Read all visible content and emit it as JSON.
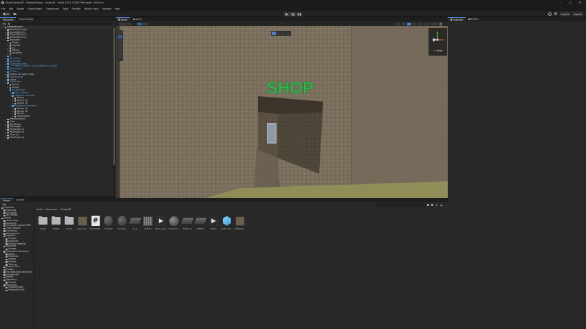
{
  "window": {
    "title": "SeanGamesVR - SampleScene - Android - Unity 2021.3.29f1 Personal* <DX11>",
    "controls": [
      "minimize",
      "maximize",
      "close"
    ]
  },
  "menu": [
    "File",
    "Edit",
    "Assets",
    "GameObject",
    "Component",
    "Tools",
    "PlayFab",
    "Mobile Input",
    "Window",
    "Help"
  ],
  "toolbar": {
    "account": "SV",
    "play": "play-icon",
    "pause": "pause-icon",
    "step": "step-icon",
    "layers": "Layers",
    "layout": "Layout"
  },
  "hierarchy": {
    "tabs": [
      "Hierarchy",
      "PlayFab EdEx"
    ],
    "items": [
      {
        "label": "SampleScene*",
        "depth": 0,
        "type": "scene"
      },
      {
        "label": "Directional Light",
        "depth": 1,
        "type": "obj"
      },
      {
        "label": "GameObject 1",
        "depth": 1,
        "type": "obj"
      },
      {
        "label": "GameObject (1)",
        "depth": 1,
        "type": "obj"
      },
      {
        "label": "GameObject (2)",
        "depth": 1,
        "type": "obj"
      },
      {
        "label": "Managers",
        "depth": 1,
        "type": "obj"
      },
      {
        "label": "Photon",
        "depth": 2,
        "type": "obj"
      },
      {
        "label": "PlayFab",
        "depth": 2,
        "type": "obj"
      },
      {
        "label": "EC",
        "depth": 2,
        "type": "obj"
      },
      {
        "label": "Menus",
        "depth": 2,
        "type": "obj"
      },
      {
        "label": "Antichest",
        "depth": 2,
        "type": "obj"
      },
      {
        "label": "UI",
        "depth": 1,
        "type": "prefab"
      },
      {
        "label": "GO_thing1",
        "depth": 1,
        "type": "prefab"
      },
      {
        "label": "GO_thing2",
        "depth": 1,
        "type": "prefab"
      },
      {
        "label": "Christmas_Trees",
        "depth": 1,
        "type": "prefab"
      },
      {
        "label": "1 P-Frame EC/Ce/0x 1/Lock Netbox EC Island",
        "depth": 1,
        "type": "prefab"
      },
      {
        "label": "Game Intro",
        "depth": 1,
        "type": "prefab"
      },
      {
        "label": "PC Tool",
        "depth": 1,
        "type": "prefab"
      },
      {
        "label": "Text for fan game shop",
        "depth": 1,
        "type": "obj"
      },
      {
        "label": "Leaderboard",
        "depth": 1,
        "type": "prefab"
      },
      {
        "label": "Lights",
        "depth": 1,
        "type": "obj"
      },
      {
        "label": "Gorilla Rig",
        "depth": 1,
        "type": "prefab"
      },
      {
        "label": "Sphere",
        "depth": 2,
        "type": "obj"
      },
      {
        "label": "Sphere",
        "depth": 2,
        "type": "obj"
      },
      {
        "label": "GorillaPlayer",
        "depth": 2,
        "type": "prefab"
      },
      {
        "label": "Main Camera",
        "depth": 3,
        "type": "prefab"
      },
      {
        "label": "LeftHand Controller",
        "depth": 3,
        "type": "prefab"
      },
      {
        "label": "Sphere",
        "depth": 4,
        "type": "obj"
      },
      {
        "label": "Sphere (1)",
        "depth": 4,
        "type": "obj"
      },
      {
        "label": "Sphere (2)",
        "depth": 4,
        "type": "obj"
      },
      {
        "label": "RightHand Controller",
        "depth": 3,
        "type": "prefab"
      },
      {
        "label": "Sphere (3)",
        "depth": 4,
        "type": "obj"
      },
      {
        "label": "Sphere (4)",
        "depth": 4,
        "type": "obj"
      },
      {
        "label": "Sphere",
        "depth": 4,
        "type": "obj"
      },
      {
        "label": "GameObject",
        "depth": 4,
        "type": "obj"
      },
      {
        "label": "MovementArea",
        "depth": 1,
        "type": "obj"
      },
      {
        "label": "Cube",
        "depth": 1,
        "type": "obj"
      },
      {
        "label": "PolyShape",
        "depth": 1,
        "type": "obj"
      },
      {
        "label": "PolyLogger",
        "depth": 1,
        "type": "obj"
      },
      {
        "label": "PolyShape (1)",
        "depth": 1,
        "type": "obj"
      },
      {
        "label": "PolyShape (2)",
        "depth": 1,
        "type": "obj"
      },
      {
        "label": "Cube (1)",
        "depth": 1,
        "type": "obj"
      },
      {
        "label": "PolyShape (3)",
        "depth": 1,
        "type": "obj"
      }
    ]
  },
  "scene": {
    "tabs": [
      "Scene",
      "Game"
    ],
    "shop_sign": "SHOP",
    "gizmo_label": "< Persp"
  },
  "inspector": {
    "tabs": [
      "Inspector",
      "Profiler"
    ]
  },
  "project": {
    "tabs": [
      "Project",
      "Console"
    ],
    "breadcrumb": [
      "Assets",
      "Resources",
      "PhotonVR"
    ],
    "tree": [
      {
        "label": "Favorites",
        "depth": 0
      },
      {
        "label": "Materials",
        "depth": 1
      },
      {
        "label": "All Models",
        "depth": 1
      },
      {
        "label": "All Prefabs",
        "depth": 1
      },
      {
        "label": "Assets",
        "depth": 0
      },
      {
        "label": "Audio Clips",
        "depth": 1
      },
      {
        "label": "AudioClip",
        "depth": 1
      },
      {
        "label": "Christmas Assets FREE",
        "depth": 1
      },
      {
        "label": "Color System",
        "depth": 1
      },
      {
        "label": "Cosmetics",
        "depth": 1
      },
      {
        "label": "Gorphys/mb",
        "depth": 1
      },
      {
        "label": "Material",
        "depth": 1
      },
      {
        "label": "Images",
        "depth": 2
      },
      {
        "label": "Materials",
        "depth": 2
      },
      {
        "label": "Physics material",
        "depth": 2
      },
      {
        "label": "Materials",
        "depth": 1
      },
      {
        "label": "Images",
        "depth": 2
      },
      {
        "label": "Minimalist Christmas",
        "depth": 1
      },
      {
        "label": "Demo",
        "depth": 2
      },
      {
        "label": "Materials",
        "depth": 2
      },
      {
        "label": "Models",
        "depth": 2
      },
      {
        "label": "Prefabs",
        "depth": 2
      },
      {
        "label": "Textures",
        "depth": 2
      },
      {
        "label": "Pixelart Pack",
        "depth": 1
      },
      {
        "label": "Photon",
        "depth": 1
      },
      {
        "label": "PlayFabEditorExtensions",
        "depth": 1
      },
      {
        "label": "PlayFabSDK",
        "depth": 1
      },
      {
        "label": "Prefab",
        "depth": 1
      },
      {
        "label": "Reporting",
        "depth": 1
      },
      {
        "label": "Scripts",
        "depth": 2
      },
      {
        "label": "Resources",
        "depth": 1
      },
      {
        "label": "GorillaPrefabs",
        "depth": 2
      },
      {
        "label": "PhotonVR Stuff",
        "depth": 2
      }
    ],
    "assets": [
      {
        "name": "Assets",
        "icon": "folder-icon"
      },
      {
        "name": "Prefabs",
        "icon": "folder-icon"
      },
      {
        "name": "Scripts",
        "icon": "folder-icon"
      },
      {
        "name": "Angry mon...",
        "icon": "texture-icon"
      },
      {
        "name": "Face/VRSet...",
        "icon": "script-icon"
      },
      {
        "name": "Fur fabric",
        "icon": "sphere-icon"
      },
      {
        "name": "Fur fabric",
        "icon": "sphere-icon"
      },
      {
        "name": "fur_2",
        "icon": "flat-mesh-icon"
      },
      {
        "name": "light_fur",
        "icon": "photo-icon"
      },
      {
        "name": "Monk_mode...",
        "icon": "anim-icon"
      },
      {
        "name": "Monkey fa...",
        "icon": "material-icon"
      },
      {
        "name": "Platform 1",
        "icon": "flat-mesh-icon"
      },
      {
        "name": "Platform",
        "icon": "flat-mesh-icon"
      },
      {
        "name": "Player",
        "icon": "anim-icon"
      },
      {
        "name": "Sprite mod...",
        "icon": "cube-icon"
      },
      {
        "name": "Untitled01...",
        "icon": "texture-icon"
      }
    ]
  }
}
